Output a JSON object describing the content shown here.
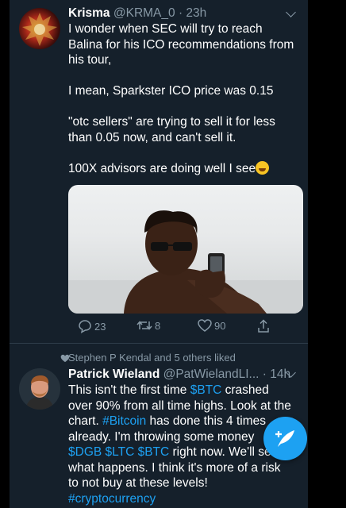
{
  "tweets": [
    {
      "name": "Krisma",
      "handle": "@KRMA_0",
      "time": "· 23h",
      "lines": [
        "I wonder when SEC will try to reach",
        "Balina for his ICO recommendations from",
        "his tour,",
        "",
        "I mean, Sparkster ICO price was 0.15",
        "",
        "\"otc sellers\" are trying to sell it for less",
        "than 0.05 now, and can't sell it.",
        "",
        "100X advisors are doing well I see"
      ],
      "replies": "23",
      "retweets": "8",
      "likes": "90"
    },
    {
      "liked_by": "Stephen P Kendal and 5 others liked",
      "name": "Patrick Wieland",
      "handle": "@PatWielandLI...",
      "time": "· 14h",
      "l1a": "This isn't the first time ",
      "l1b": "$BTC",
      "l1c": " crashed",
      "l2": "over 90% from all time highs. Look at the",
      "l3a": "chart. ",
      "l3b": "#Bitcoin",
      "l3c": " has done this 4 times",
      "l4": "already. I'm throwing some money",
      "l5a": "$DGB $LTC $BTC",
      "l5b": " right now. We'll see",
      "l6": "what happens. I think it's more of a risk",
      "l7": "to not buy at these levels!",
      "l8": "#cryptocurrency"
    }
  ],
  "icons": {
    "reply": "reply-icon",
    "retweet": "retweet-icon",
    "like": "heart-icon",
    "share": "share-icon",
    "compose": "compose-icon",
    "emoji": "rofl-emoji-icon"
  },
  "colors": {
    "background": "#15202b",
    "accent": "#1da1f2",
    "muted": "#8899a6"
  }
}
